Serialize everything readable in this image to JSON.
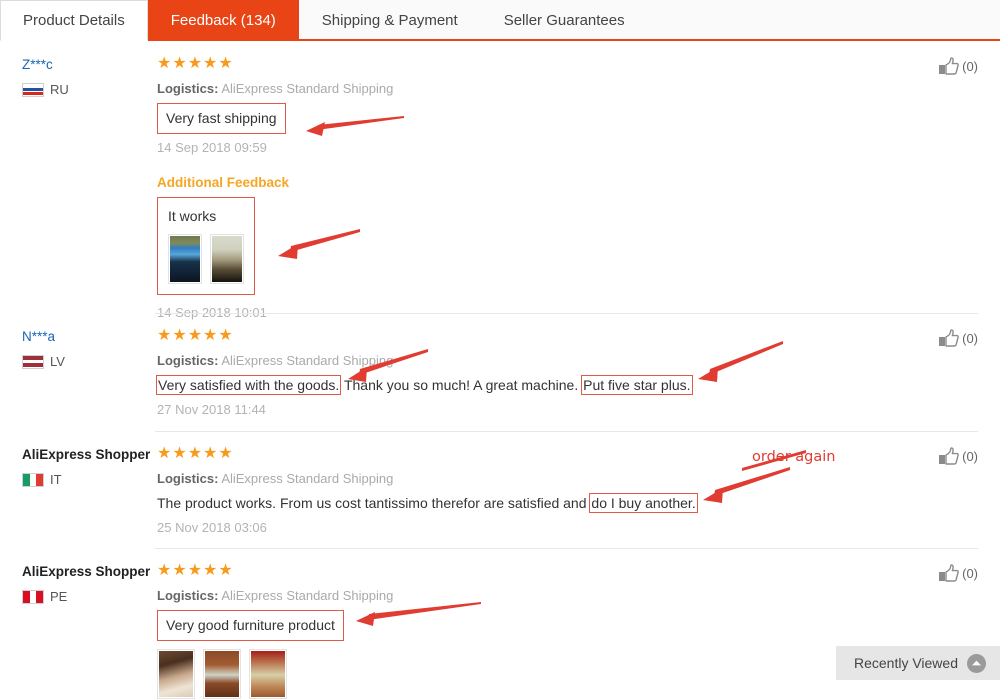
{
  "tabs": [
    {
      "label": "Product Details",
      "active": false
    },
    {
      "label": "Feedback (134)",
      "active": true
    },
    {
      "label": "Shipping & Payment",
      "active": false
    },
    {
      "label": "Seller Guarantees",
      "active": false
    }
  ],
  "colors": {
    "accent": "#e84415",
    "star": "#f79b1e",
    "annotation": "#e03c31",
    "link": "#1866b3",
    "additional_feedback": "#f5a623"
  },
  "logistics_label": "Logistics:",
  "logistics_value": "AliExpress Standard Shipping",
  "like_count": "(0)",
  "like_icon": "thumbs-up-icon",
  "stars": "★★★★★",
  "reviews": [
    {
      "username": "Z***c",
      "username_is_link": true,
      "country_code": "RU",
      "flag": "flag-ru",
      "rating": 5,
      "comment": "Very fast shipping",
      "comment_boxed": true,
      "date": "14 Sep 2018 09:59",
      "like_count": "(0)",
      "additional": {
        "title": "Additional Feedback",
        "text": "It works",
        "date": "14 Sep 2018 10:01",
        "photo_count": 2
      }
    },
    {
      "username": "N***a",
      "username_is_link": true,
      "country_code": "LV",
      "flag": "flag-lv",
      "rating": 5,
      "comment_parts": [
        {
          "text": "Very satisfied with the goods.",
          "boxed": true
        },
        {
          "text": " Thank you so much! A great machine. ",
          "boxed": false
        },
        {
          "text": "Put five star plus.",
          "boxed": true
        }
      ],
      "date": "27 Nov 2018 11:44",
      "like_count": "(0)"
    },
    {
      "username": "AliExpress Shopper",
      "username_is_link": false,
      "country_code": "IT",
      "flag": "flag-it",
      "rating": 5,
      "comment_parts": [
        {
          "text": "The product works. From us cost tantissimo therefor are satisfied and ",
          "boxed": false
        },
        {
          "text": "do I buy another.",
          "boxed": true
        }
      ],
      "date": "25 Nov 2018 03:06",
      "like_count": "(0)"
    },
    {
      "username": "AliExpress Shopper",
      "username_is_link": false,
      "country_code": "PE",
      "flag": "flag-pe",
      "rating": 5,
      "comment": "Very good furniture product",
      "comment_boxed": true,
      "photo_count": 3,
      "like_count": "(0)"
    }
  ],
  "annotations": [
    {
      "type": "arrow",
      "target": "Very fast shipping"
    },
    {
      "type": "arrow",
      "target": "It works photos"
    },
    {
      "type": "arrow",
      "target": "Very satisfied with the goods."
    },
    {
      "type": "arrow",
      "target": "Put five star plus."
    },
    {
      "type": "arrow",
      "target": "do I buy another."
    },
    {
      "type": "arrow",
      "target": "Very good furniture product"
    },
    {
      "type": "text",
      "text": "order again"
    }
  ],
  "recently_viewed": {
    "label": "Recently Viewed",
    "icon": "chevron-up-icon"
  }
}
